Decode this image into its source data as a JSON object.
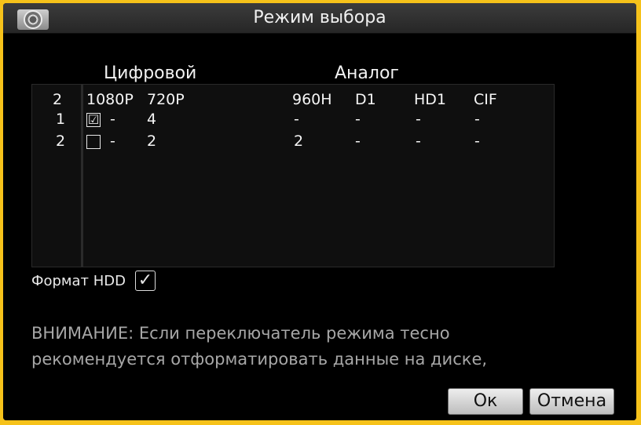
{
  "window": {
    "title": "Режим выбора"
  },
  "headers": {
    "digital": "Цифровой",
    "analog": "Аналог"
  },
  "table": {
    "columns": {
      "index": "2",
      "r1080p": "1080P",
      "r720p": "720P",
      "r960h": "960H",
      "d1": "D1",
      "hd1": "HD1",
      "cif": "CIF"
    },
    "rows": [
      {
        "index": "1",
        "checked": true,
        "check_glyph": "☑",
        "v1080p": "-",
        "v720p": "4",
        "v960h": "-",
        "vd1": "-",
        "vhd1": "-",
        "vcif": "-"
      },
      {
        "index": "2",
        "checked": false,
        "check_glyph": "",
        "v1080p": "-",
        "v720p": "2",
        "v960h": "2",
        "vd1": "-",
        "vhd1": "-",
        "vcif": "-"
      }
    ]
  },
  "hdd": {
    "label": "Формат HDD",
    "checked": true,
    "glyph": "✓"
  },
  "warning": {
    "line1": "ВНИМАНИЕ: Если переключатель режима тесно",
    "line2": "рекомендуется отформатировать данные на диске,"
  },
  "buttons": {
    "ok": "Ок",
    "cancel": "Отмена"
  }
}
